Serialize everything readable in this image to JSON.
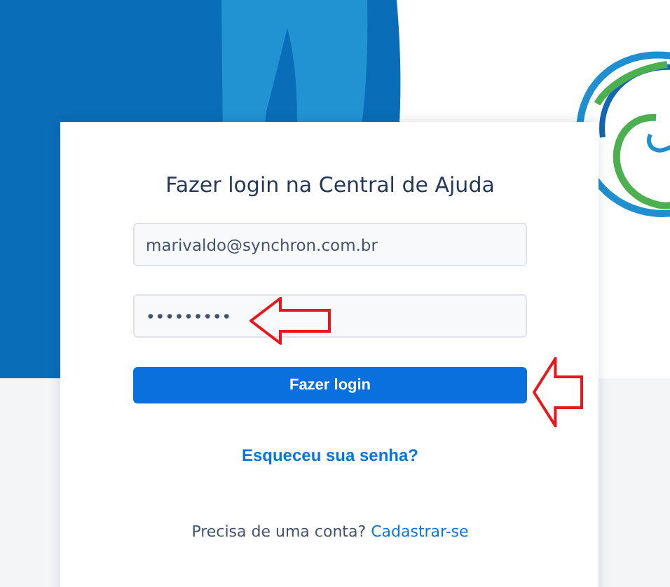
{
  "login_card": {
    "title": "Fazer login na Central de Ajuda",
    "email_field": {
      "value": "marivaldo@synchron.com.br"
    },
    "password_field": {
      "value": "•••••••••"
    },
    "submit_button": {
      "label": "Fazer login"
    },
    "forgot_link": {
      "label": "Esqueceu sua senha?"
    },
    "signup": {
      "prompt": "Precisa de uma conta?",
      "link": "Cadastrar-se"
    }
  },
  "annotations": [
    {
      "kind": "arrow"
    },
    {
      "kind": "arrow"
    }
  ]
}
